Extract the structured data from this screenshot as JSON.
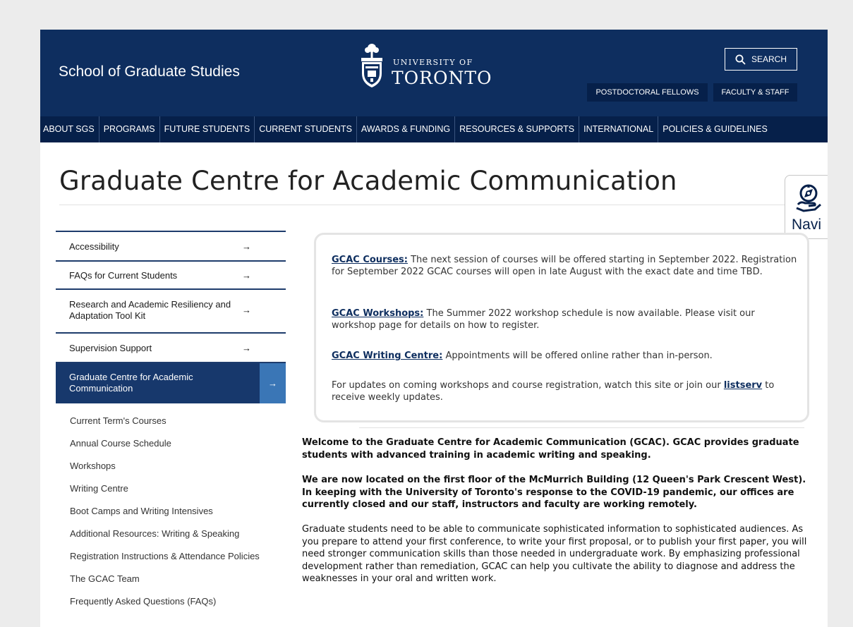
{
  "header": {
    "site_title": "School of Graduate Studies",
    "logo_line1": "UNIVERSITY OF",
    "logo_line2": "TORONTO",
    "search_label": "SEARCH",
    "postdoc_label": "POSTDOCTORAL FELLOWS",
    "faculty_label": "FACULTY & STAFF"
  },
  "nav": {
    "items": [
      "ABOUT SGS",
      "PROGRAMS",
      "FUTURE STUDENTS",
      "CURRENT STUDENTS",
      "AWARDS & FUNDING",
      "RESOURCES & SUPPORTS",
      "INTERNATIONAL",
      "POLICIES & GUIDELINES"
    ]
  },
  "page": {
    "title": "Graduate Centre for Academic Communication"
  },
  "navi_widget": {
    "label": "Navi"
  },
  "sidebar": {
    "arrow": "→",
    "items": [
      "Accessibility",
      "FAQs for Current Students",
      "Research and Academic Resiliency and Adaptation Tool Kit",
      "Supervision Support",
      "Graduate Centre for Academic Communication"
    ],
    "sub_items": [
      "Current Term's Courses",
      "Annual Course Schedule",
      "Workshops",
      "Writing Centre",
      "Boot Camps and Writing Intensives",
      "Additional Resources: Writing & Speaking",
      "Registration Instructions & Attendance Policies",
      "The GCAC Team",
      "Frequently Asked Questions (FAQs)"
    ]
  },
  "notice": {
    "courses_link": "GCAC Courses:",
    "courses_text": " The next session of courses will be offered starting in September 2022. Registration for September 2022 GCAC courses will open in late August with the exact date and time TBD.",
    "workshops_link": "GCAC Workshops:",
    "workshops_text": " The Summer 2022 workshop schedule is now available. Please visit our workshop page for details on how to register.",
    "writing_link": "GCAC Writing Centre:",
    "writing_text": " Appointments will be offered online rather than in-person.",
    "updates_text": "For updates on coming workshops and course registration, watch this site or join our ",
    "listserv_link": "listserv",
    "updates_tail": " to receive weekly updates."
  },
  "content": {
    "welcome": "Welcome to the Graduate Centre for Academic Communication (GCAC). GCAC provides graduate students with advanced training in academic writing and speaking.",
    "location": "We are now located on the first floor of the McMurrich Building (12 Queen's Park Crescent West). In keeping with the University of Toronto's response to the COVID-19 pandemic, our offices are currently closed and our staff, instructors and faculty are working remotely.",
    "intro": "Graduate students need to be able to communicate sophisticated information to sophisticated audiences. As you prepare to attend your first conference, to write your first proposal, or to publish your first paper, you will need stronger communication skills than those needed in undergraduate work. By emphasizing professional development rather than remediation, GCAC can help you cultivate the ability to diagnose and address the weaknesses in your oral and written work."
  }
}
